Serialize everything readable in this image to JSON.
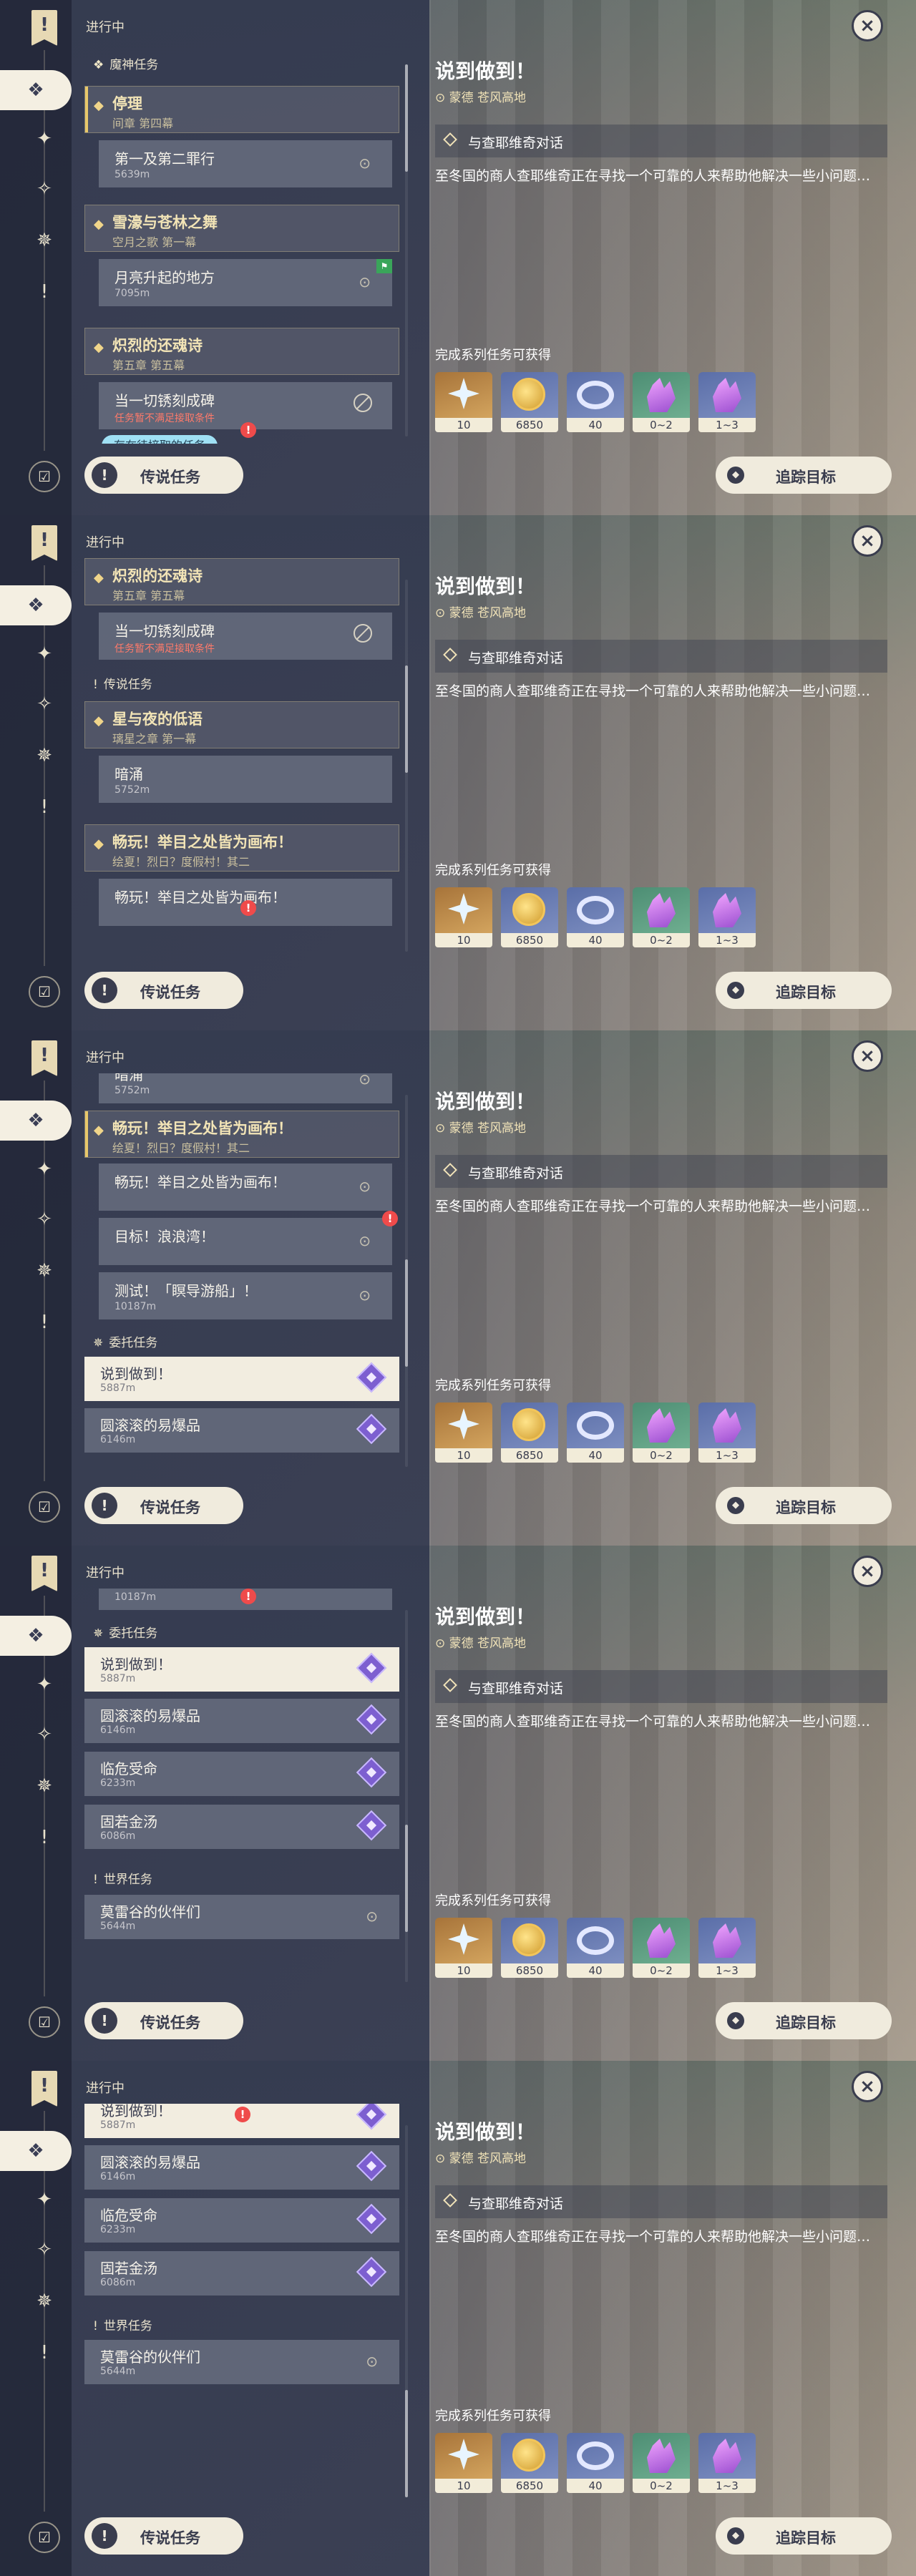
{
  "ui": {
    "in_progress": "进行中",
    "close_symbol": "×",
    "legend_button": "传说任务",
    "track_button": "追踪目标",
    "pending_badge": "存在待接取的任务"
  },
  "detail": {
    "title": "说到做到！",
    "location": "蒙德 苍风高地",
    "objective": "与查耶维奇对话",
    "description": "至冬国的商人查耶维奇正在寻找一个可靠的人来帮助他解决一些小问题…",
    "rewards_title": "完成系列任务可获得",
    "rewards": [
      {
        "icon": "primogem-icon",
        "qty": "10",
        "bg": "gold"
      },
      {
        "icon": "mora-icon",
        "qty": "6850",
        "bg": "blue"
      },
      {
        "icon": "adventure-exp-icon",
        "qty": "40",
        "bg": "blue"
      },
      {
        "icon": "crystal-chunk-icon",
        "qty": "0~2",
        "bg": "green"
      },
      {
        "icon": "crystal-ore-icon",
        "qty": "1~3",
        "bg": "blue"
      }
    ]
  },
  "categories": {
    "archon": "魔神任务",
    "legend": "传说任务",
    "commission": "委托任务",
    "world": "世界任务"
  },
  "quests": {
    "tingli": {
      "title": "停理",
      "subtitle": "间章 第四幕"
    },
    "sin": {
      "name": "第一及第二罪行",
      "distance": "5639m"
    },
    "snow": {
      "title": "雪濠与苍林之舞",
      "subtitle": "空月之歌 第一幕"
    },
    "moon": {
      "name": "月亮升起的地方",
      "distance": "7095m"
    },
    "blaze": {
      "title": "炽烈的还魂诗",
      "subtitle": "第五章 第五幕"
    },
    "rust": {
      "name": "当一切锈刻成碑",
      "note": "任务暂不满足接取条件"
    },
    "star": {
      "title": "星与夜的低语",
      "subtitle": "璃星之章 第一幕"
    },
    "undercurrent": {
      "name": "暗涌",
      "distance": "5752m"
    },
    "fun": {
      "title": "畅玩！举目之处皆为画布！",
      "subtitle": "绘夏！烈日？度假村！其二"
    },
    "fun_step": {
      "name": "畅玩！举目之处皆为画布！"
    },
    "wave": {
      "name": "目标！浪浪湾！"
    },
    "boat": {
      "name": "测试！「瞑导游船」！",
      "distance": "10187m"
    },
    "say": {
      "name": "说到做到！",
      "distance": "5887m"
    },
    "rolling": {
      "name": "圆滚滚的易爆品",
      "distance": "6146m"
    },
    "danger": {
      "name": "临危受命",
      "distance": "6233m"
    },
    "golden": {
      "name": "固若金汤",
      "distance": "6086m"
    },
    "morei": {
      "name": "莫雷谷的伙伴们",
      "distance": "5644m"
    }
  }
}
